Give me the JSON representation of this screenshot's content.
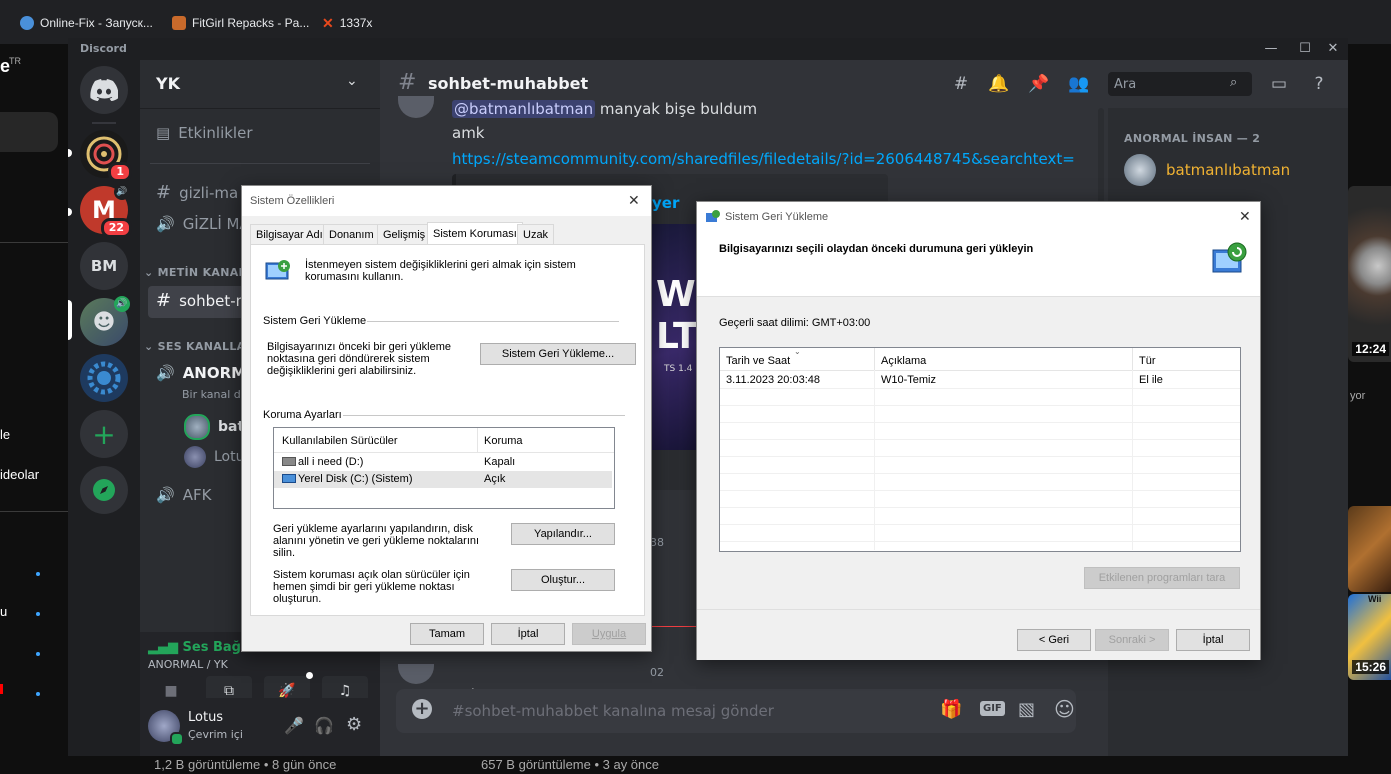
{
  "browser_tabs": [
    {
      "label": "Online-Fix - Запуск...",
      "color": "#4a90d9"
    },
    {
      "label": "FitGirl Repacks - Pa...",
      "color": "#c96a2b"
    },
    {
      "label": "1337x",
      "color": "#e8491d"
    }
  ],
  "youtube": {
    "left_texts": [
      "TR",
      "le",
      "ideolar",
      "u"
    ],
    "durations": [
      "12:24",
      "15:26"
    ],
    "right_text": "yor",
    "thumb_brand": "Wii",
    "bottom_meta": [
      "1,2 B görüntüleme • 8 gün önce",
      "657 B görüntüleme • 3 ay önce"
    ]
  },
  "discord": {
    "title": "Discord",
    "server_name": "YK",
    "guilds": {
      "badges": [
        "1",
        "22"
      ],
      "bm_label": "BM"
    },
    "channels": {
      "events": "Etkinlikler",
      "gizli_text": "gizli-ma",
      "gizli_voice": "GİZLİ MA",
      "text_category": "METİN KANALL",
      "current_channel": "sohbet-m",
      "voice_category": "SES KANALLAR",
      "voice_channel": "ANORMA",
      "voice_sub": "Bir kanal do",
      "voice_users": [
        "batr",
        "Lotu"
      ],
      "afk": "AFK"
    },
    "voice_panel": {
      "status": "Ses Bağlant",
      "channel": "ANORMAL / YK"
    },
    "user": {
      "name": "Lotus",
      "status": "Çevrim içi"
    },
    "chat": {
      "channel_name": "sohbet-muhabbet",
      "search_placeholder": "Ara",
      "mention": "@batmanlıbatman",
      "mention_rest": " manyak bişe buldum",
      "msg_amk": "amk",
      "link": "https://steamcommunity.com/sharedfiles/filedetails/?id=2606448745&searchtext=",
      "embed_title": "yer",
      "embed_letters": "W",
      "embed_letters2": "LTI",
      "embed_small": "TS 1.4",
      "fragment_time": "38",
      "fragment_time2": "02",
      "fragment_msg": "gel",
      "input_placeholder": "#sohbet-muhabbet kanalına mesaj gönder",
      "gif_label": "GIF"
    },
    "members": {
      "category": "ANORMAL İNSAN — 2",
      "member1": "batmanlıbatman"
    }
  },
  "sys_props": {
    "title": "Sistem Özellikleri",
    "tabs": [
      "Bilgisayar Adı",
      "Donanım",
      "Gelişmiş",
      "Sistem Koruması",
      "Uzak"
    ],
    "intro": "İstenmeyen sistem değişikliklerini geri almak için sistem korumasını kullanın.",
    "restore_group": "Sistem Geri Yükleme",
    "restore_desc": "Bilgisayarınızı önceki bir geri yükleme noktasına geri döndürerek sistem değişikliklerini geri alabilirsiniz.",
    "restore_button": "Sistem Geri Yükleme...",
    "protect_group": "Koruma Ayarları",
    "table_headers": [
      "Kullanılabilen Sürücüler",
      "Koruma"
    ],
    "drives": [
      {
        "name": "all i need (D:)",
        "protection": "Kapalı"
      },
      {
        "name": "Yerel Disk (C:) (Sistem)",
        "protection": "Açık"
      }
    ],
    "configure_desc": "Geri yükleme ayarlarını yapılandırın, disk alanını yönetin ve geri yükleme noktalarını silin.",
    "configure_button": "Yapılandır...",
    "create_desc": "Sistem koruması açık olan sürücüler için hemen şimdi bir geri yükleme noktası oluşturun.",
    "create_button": "Oluştur...",
    "ok": "Tamam",
    "cancel": "İptal",
    "apply": "Uygula"
  },
  "sys_restore": {
    "title": "Sistem Geri Yükleme",
    "heading": "Bilgisayarınızı seçili olaydan önceki durumuna geri yükleyin",
    "timezone": "Geçerli saat dilimi: GMT+03:00",
    "columns": [
      "Tarih ve Saat",
      "Açıklama",
      "Tür"
    ],
    "rows": [
      {
        "date": "3.11.2023 20:03:48",
        "desc": "W10-Temiz",
        "type": "El ile"
      }
    ],
    "scan_button": "Etkilenen programları tara",
    "back": "< Geri",
    "next": "Sonraki >",
    "cancel": "İptal"
  },
  "colors": {
    "discord_bg": "#313338",
    "discord_sidebar": "#2b2d31",
    "discord_rail": "#1e1f22",
    "link": "#00a8fc",
    "mention_bg": "#3c4270",
    "online": "#23a55a",
    "danger": "#f23f43",
    "gold_name": "#f0b232"
  }
}
